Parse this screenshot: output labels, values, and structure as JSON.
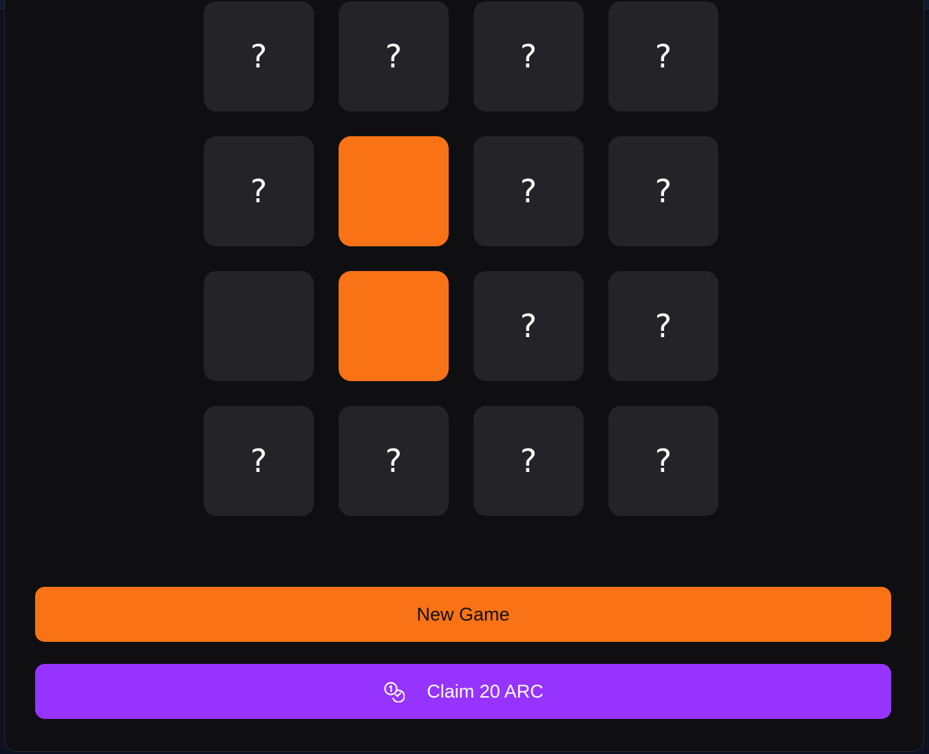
{
  "board": {
    "tiles": [
      {
        "state": "hidden",
        "label": "?"
      },
      {
        "state": "hidden",
        "label": "?"
      },
      {
        "state": "hidden",
        "label": "?"
      },
      {
        "state": "hidden",
        "label": "?"
      },
      {
        "state": "hidden",
        "label": "?"
      },
      {
        "state": "revealed",
        "label": ""
      },
      {
        "state": "hidden",
        "label": "?"
      },
      {
        "state": "hidden",
        "label": "?"
      },
      {
        "state": "empty",
        "label": ""
      },
      {
        "state": "revealed",
        "label": ""
      },
      {
        "state": "hidden",
        "label": "?"
      },
      {
        "state": "hidden",
        "label": "?"
      },
      {
        "state": "hidden",
        "label": "?"
      },
      {
        "state": "hidden",
        "label": "?"
      },
      {
        "state": "hidden",
        "label": "?"
      },
      {
        "state": "hidden",
        "label": "?"
      }
    ]
  },
  "actions": {
    "new_game_label": "New Game",
    "claim_label": "Claim 20 ARC",
    "claim_icon": "coins-icon"
  },
  "colors": {
    "accent_orange": "#f97316",
    "accent_purple": "#9733ff",
    "tile_bg": "#242428",
    "panel_bg": "#0f0f11"
  }
}
